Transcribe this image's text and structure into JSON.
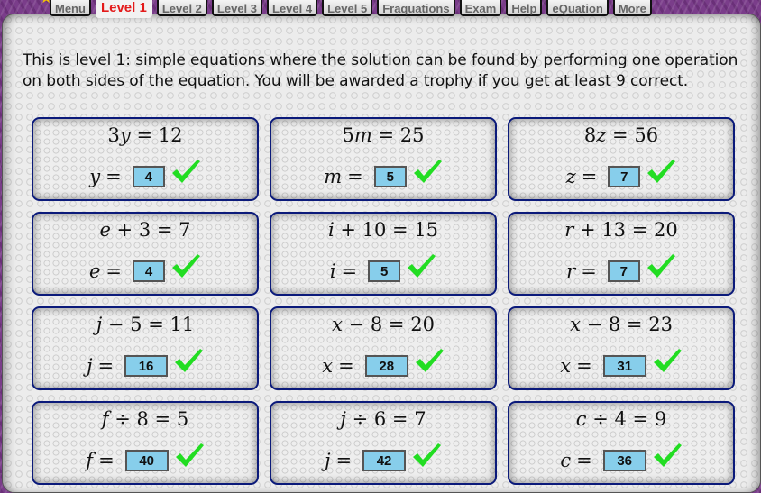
{
  "nav": {
    "tabs": [
      {
        "label": "Menu",
        "active": false
      },
      {
        "label": "Level 1",
        "active": true
      },
      {
        "label": "Level 2",
        "active": false
      },
      {
        "label": "Level 3",
        "active": false
      },
      {
        "label": "Level 4",
        "active": false
      },
      {
        "label": "Level 5",
        "active": false
      },
      {
        "label": "Fraquations",
        "active": false
      },
      {
        "label": "Exam",
        "active": false
      },
      {
        "label": "Help",
        "active": false
      },
      {
        "label": "eQuation",
        "active": false
      },
      {
        "label": "More",
        "active": false
      }
    ]
  },
  "intro": {
    "text": "This is level 1: simple equations where the solution can be found by performing one operation on both sides of the equation. You will be awarded a trophy if you get at least 9 correct."
  },
  "colors": {
    "card_border": "#0b1a7a",
    "answer_box": "#87ceeb",
    "check": "#22dd22",
    "active_tab": "#e31a1a"
  },
  "questions": [
    {
      "lhs": "3y",
      "rhs": "12",
      "variable": "y",
      "answer": "4",
      "correct": true,
      "icon": "check-icon"
    },
    {
      "lhs": "5m",
      "rhs": "25",
      "variable": "m",
      "answer": "5",
      "correct": true,
      "icon": "check-icon"
    },
    {
      "lhs": "8z",
      "rhs": "56",
      "variable": "z",
      "answer": "7",
      "correct": true,
      "icon": "check-icon"
    },
    {
      "lhs": "e + 3",
      "rhs": "7",
      "variable": "e",
      "answer": "4",
      "correct": true,
      "icon": "check-icon"
    },
    {
      "lhs": "i + 10",
      "rhs": "15",
      "variable": "i",
      "answer": "5",
      "correct": true,
      "icon": "check-icon"
    },
    {
      "lhs": "r + 13",
      "rhs": "20",
      "variable": "r",
      "answer": "7",
      "correct": true,
      "icon": "check-icon"
    },
    {
      "lhs": "j − 5",
      "rhs": "11",
      "variable": "j",
      "answer": "16",
      "correct": true,
      "icon": "check-icon"
    },
    {
      "lhs": "x − 8",
      "rhs": "20",
      "variable": "x",
      "answer": "28",
      "correct": true,
      "icon": "check-icon"
    },
    {
      "lhs": "x − 8",
      "rhs": "23",
      "variable": "x",
      "answer": "31",
      "correct": true,
      "icon": "check-icon"
    },
    {
      "lhs": "f ÷ 8",
      "rhs": "5",
      "variable": "f",
      "answer": "40",
      "correct": true,
      "icon": "check-icon"
    },
    {
      "lhs": "j ÷ 6",
      "rhs": "7",
      "variable": "j",
      "answer": "42",
      "correct": true,
      "icon": "check-icon"
    },
    {
      "lhs": "c ÷ 4",
      "rhs": "9",
      "variable": "c",
      "answer": "36",
      "correct": true,
      "icon": "check-icon"
    }
  ],
  "symbols": {
    "equals": "="
  }
}
